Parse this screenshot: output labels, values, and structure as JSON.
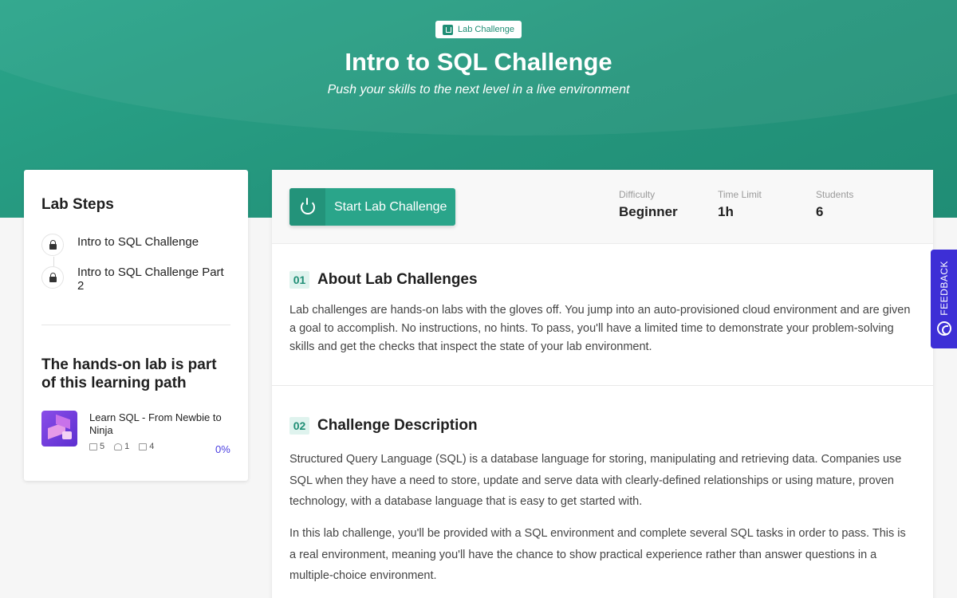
{
  "hero": {
    "badge_label": "Lab Challenge",
    "title": "Intro to SQL Challenge",
    "subtitle": "Push your skills to the next level in a live environment"
  },
  "sidebar": {
    "steps_title": "Lab Steps",
    "steps": [
      {
        "label": "Intro to SQL Challenge"
      },
      {
        "label": "Intro to SQL Challenge Part 2"
      }
    ],
    "path_heading": "The hands-on lab is part of this learning path",
    "path": {
      "title": "Learn SQL - From Newbie to Ninja",
      "stats": [
        "5",
        "1",
        "4"
      ],
      "percent": "0%"
    }
  },
  "main": {
    "start_label": "Start Lab Challenge",
    "meta": [
      {
        "key": "Difficulty",
        "value": "Beginner"
      },
      {
        "key": "Time Limit",
        "value": "1h"
      },
      {
        "key": "Students",
        "value": "6"
      }
    ],
    "sections": [
      {
        "num": "01",
        "title": "About Lab Challenges",
        "paragraphs": [
          "Lab challenges are hands-on labs with the gloves off. You jump into an auto-provisioned cloud environment and are given a goal to accomplish. No instructions, no hints. To pass, you'll have a limited time to demonstrate your problem-solving skills and get the checks that inspect the state of your lab environment."
        ]
      },
      {
        "num": "02",
        "title": "Challenge Description",
        "paragraphs": [
          "Structured Query Language (SQL) is a database language for storing, manipulating and retrieving data. Companies use SQL when they have a need to store, update and serve data with clearly-defined relationships or using mature, proven technology, with a database language that is easy to get started with.",
          "In this lab challenge, you'll be provided with a SQL environment and complete several SQL tasks in order to pass. This is a real environment, meaning you'll have the chance to show practical experience rather than answer questions in a multiple-choice environment."
        ]
      }
    ]
  },
  "feedback_label": "FEEDBACK",
  "colors": {
    "brand": "#2aa58a",
    "accent": "#3d2fd6"
  }
}
